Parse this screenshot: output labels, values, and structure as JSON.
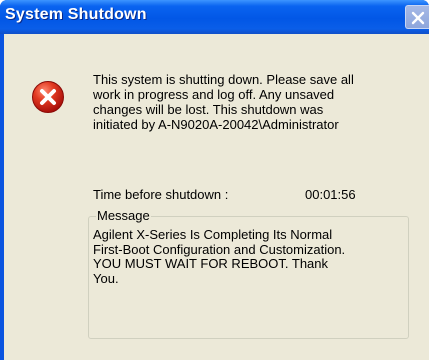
{
  "window": {
    "title": "System Shutdown"
  },
  "icons": {
    "title_close": "close-icon",
    "error": "error-icon"
  },
  "dialog": {
    "message": "This system is shutting down. Please save all\nwork in progress and log off. Any unsaved\nchanges will be lost. This shutdown was\ninitiated by A-N9020A-20042\\Administrator",
    "time_label": "Time before shutdown :",
    "time_value": "00:01:56",
    "group_label": "Message",
    "group_message": "Agilent X-Series Is Completing Its Normal\nFirst-Boot Configuration and Customization.\nYOU MUST WAIT FOR REBOOT. Thank\nYou."
  },
  "colors": {
    "titlebar": "#0a5ee8",
    "dialog_bg": "#ece9d8",
    "error_red": "#d42a1e"
  }
}
